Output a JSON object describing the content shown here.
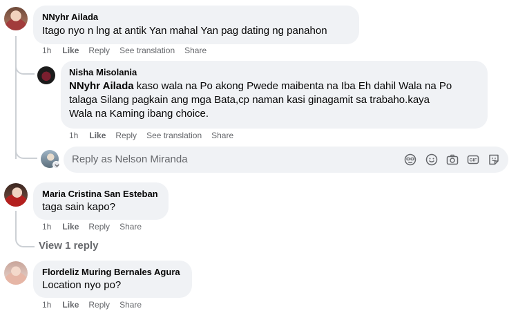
{
  "comments": [
    {
      "author": "NNyhr Ailada",
      "text": "Itago nyo n lng at antik Yan mahal Yan pag dating ng panahon",
      "time": "1h",
      "like": "Like",
      "reply": "Reply",
      "translate": "See translation",
      "share": "Share"
    },
    {
      "author": "Maria Cristina San Esteban",
      "text": "taga sain kapo?",
      "time": "1h",
      "like": "Like",
      "reply": "Reply",
      "share": "Share",
      "view_replies": "View 1 reply"
    },
    {
      "author": "Flordeliz Muring Bernales Agura",
      "text": "Location nyo po?",
      "time": "1h",
      "like": "Like",
      "reply": "Reply",
      "share": "Share"
    }
  ],
  "reply": {
    "author": "Nisha Misolania",
    "mention": "NNyhr Ailada",
    "line1": " kaso wala na Po akong Pwede maibenta na Iba Eh dahil Wala na Po",
    "line2": "talaga Silang pagkain ang mga Bata,cp naman kasi ginagamit sa trabaho.kaya",
    "line3": "Wala na Kaming ibang choice.",
    "time": "1h",
    "like": "Like",
    "reply": "Reply",
    "translate": "See translation",
    "share": "Share"
  },
  "reply_box": {
    "placeholder": "Reply as Nelson Miranda",
    "icons": [
      "avatar-sticker-icon",
      "emoji-icon",
      "camera-icon",
      "gif-icon",
      "sticker-icon"
    ]
  },
  "colors": {
    "bubble": "#f0f2f5",
    "secondary_text": "#65676b",
    "thread_line": "#ccd0d5"
  }
}
